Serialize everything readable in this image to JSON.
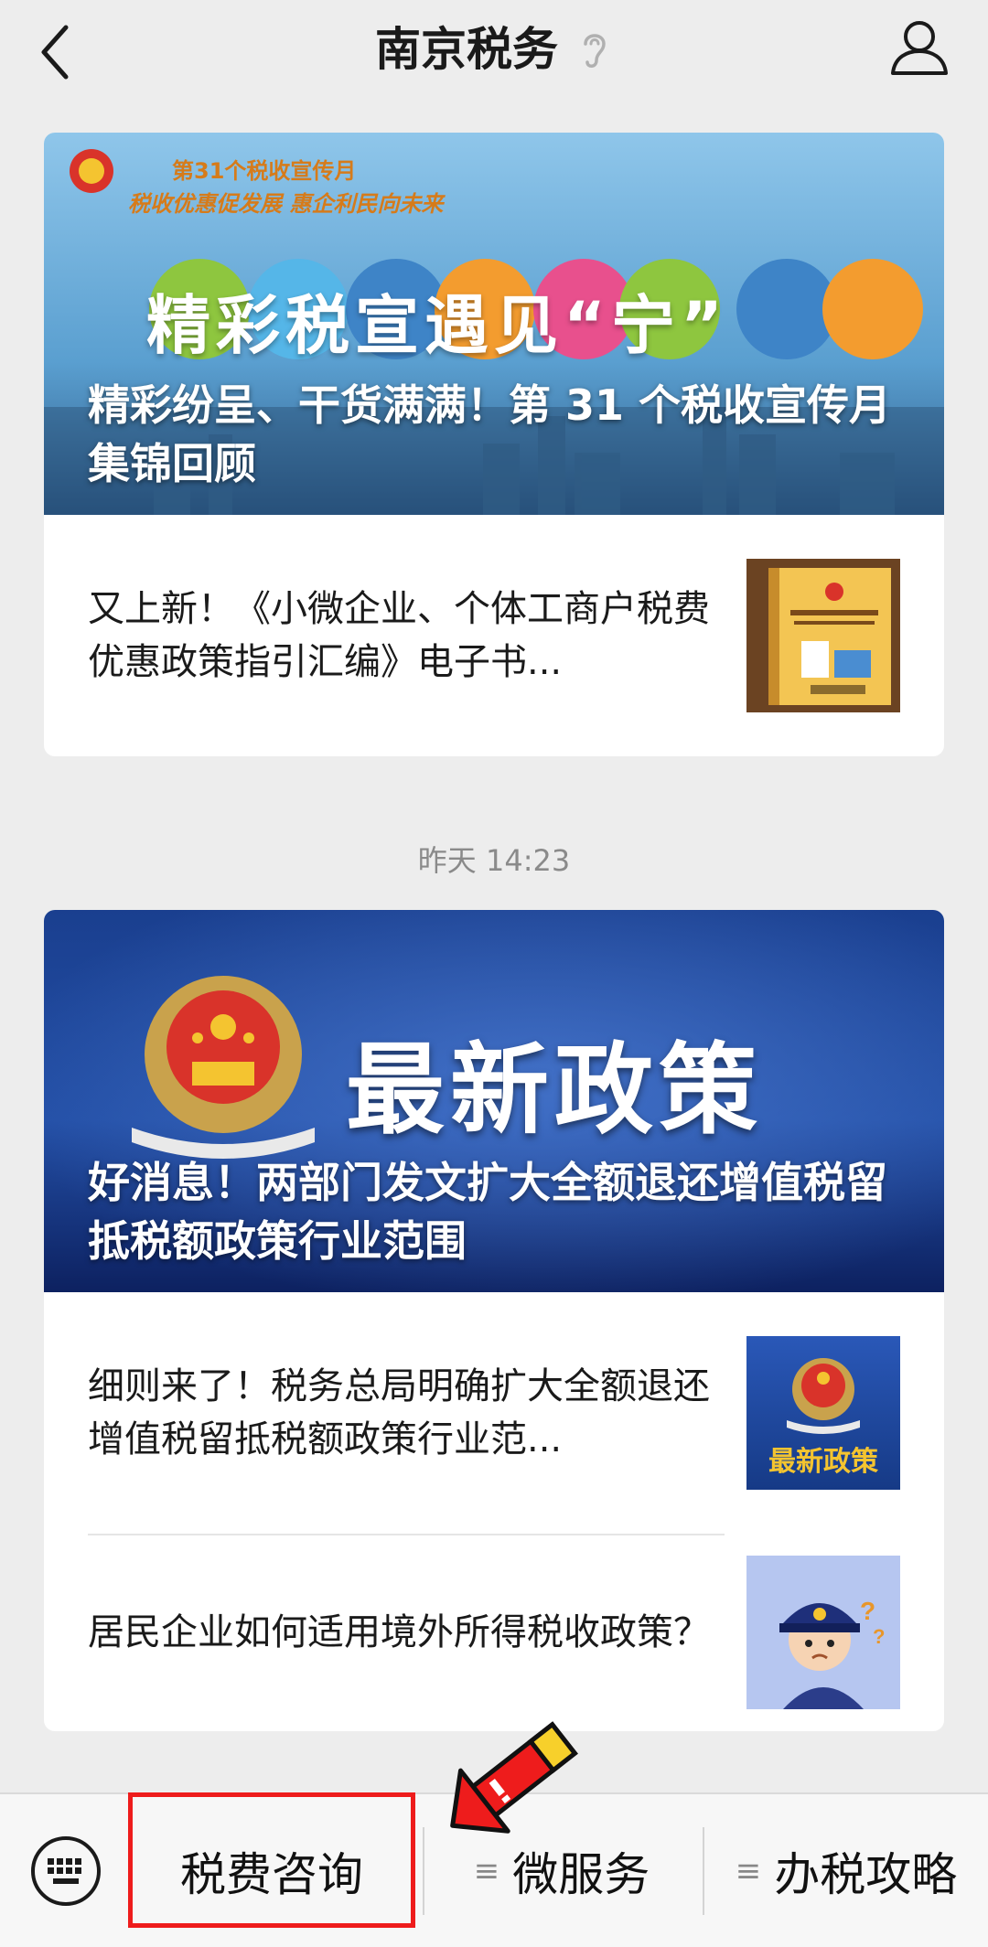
{
  "header": {
    "title": "南京税务",
    "back_icon": "chevron-left-icon",
    "sound_icon": "ear-icon",
    "profile_icon": "user-icon"
  },
  "articles_1": {
    "banner_text_line1": "第31个税收宣传月",
    "banner_text_line2": "税收优惠促发展 惠企利民向未来",
    "banner_big_text": "精彩税宣遇见“宁”",
    "hero_title": "精彩纷呈、干货满满！第 31 个税收宣传月集锦回顾",
    "items": [
      {
        "title": "又上新！《小微企业、个体工商户税费优惠政策指引汇编》电子书..."
      }
    ]
  },
  "timestamp": "昨天 14:23",
  "articles_2": {
    "banner_big_text": "最新政策",
    "hero_title": "好消息！两部门发文扩大全额退还增值税留抵税额政策行业范围",
    "items": [
      {
        "title": "细则来了！税务总局明确扩大全额退还增值税留抵税额政策行业范...",
        "thumb_text": "最新政策"
      },
      {
        "title": "居民企业如何适用境外所得税收政策？"
      }
    ]
  },
  "bottom_menu": {
    "keyboard_icon": "keyboard-icon",
    "items": [
      {
        "label": "税费咨询"
      },
      {
        "label": "微服务"
      },
      {
        "label": "办税攻略"
      }
    ]
  },
  "colors": {
    "highlight": "#ee1c1c",
    "arrow": "#ee1c1c"
  }
}
